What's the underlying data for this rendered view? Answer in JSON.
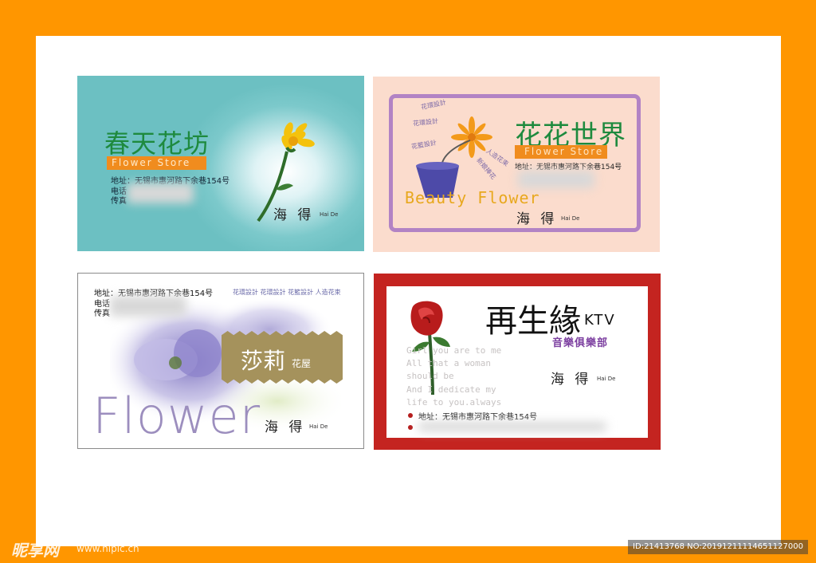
{
  "cards": {
    "spring": {
      "title": "春天花坊",
      "subtitle": "Flower Store",
      "address": "地址：无锡市惠河路下余巷154号",
      "phone_label": "电话",
      "fax_label": "传真",
      "name": "海 得",
      "name_en": "Hai De"
    },
    "world": {
      "title": "花花世界",
      "subtitle": "Flower Store",
      "address": "地址：无锡市惠河路下余巷154号",
      "slogan": "Beauty Flower",
      "name": "海 得",
      "name_en": "Hai De",
      "tags": [
        "花環設計",
        "花環設計",
        "花籃設計",
        "人造花束",
        "新娘捧花"
      ]
    },
    "lily": {
      "address": "地址：无锡市惠河路下余巷154号",
      "phone_label": "电话",
      "fax_label": "传真",
      "services": "花環設計  花環設計  花籃設計  人造花束",
      "brand": "莎莉",
      "brand_sub": "花屋",
      "big_text": "Flower",
      "name": "海 得",
      "name_en": "Hai De"
    },
    "ktv": {
      "title": "再生緣",
      "title_suffix": "KTV",
      "club": "音樂俱樂部",
      "poem": [
        "Girl you are to me",
        "All that a woman",
        "should be",
        "And I dedicate my",
        "life to you.always"
      ],
      "name": "海 得",
      "name_en": "Hai De",
      "address": "地址：无锡市惠河路下余巷154号"
    }
  },
  "watermark": {
    "logo": "昵享网",
    "url": "www.nipic.cn",
    "id": "ID:21413768 NO:20191211114651127000"
  },
  "colors": {
    "outer_border": "#ff9600",
    "green_title": "#1e8a3e",
    "orange_ribbon": "#f08c1e",
    "ktv_red": "#c42420"
  }
}
